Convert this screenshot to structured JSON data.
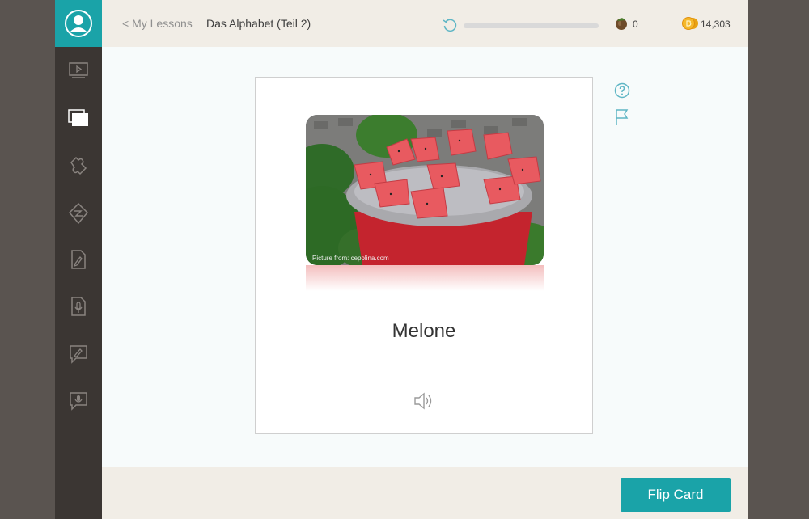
{
  "header": {
    "back_label": "< My Lessons",
    "lesson_title": "Das Alphabet (Teil 2)",
    "progress_fraction": 0,
    "nuts_count": "0",
    "coins_count": "14,303"
  },
  "sidebar": {
    "items": [
      {
        "icon": "video-icon"
      },
      {
        "icon": "flashcards-icon"
      },
      {
        "icon": "puzzle-icon"
      },
      {
        "icon": "word-builder-icon"
      },
      {
        "icon": "writing-icon"
      },
      {
        "icon": "listening-icon"
      },
      {
        "icon": "speech-writing-icon"
      },
      {
        "icon": "speaking-icon"
      }
    ]
  },
  "card": {
    "word": "Melone",
    "photo_credit": "Picture from: cepolina.com"
  },
  "footer": {
    "flip_label": "Flip Card"
  },
  "colors": {
    "accent": "#1aa3a8",
    "sidebar_bg": "#3b3633",
    "topbar_bg": "#f1ede6"
  }
}
